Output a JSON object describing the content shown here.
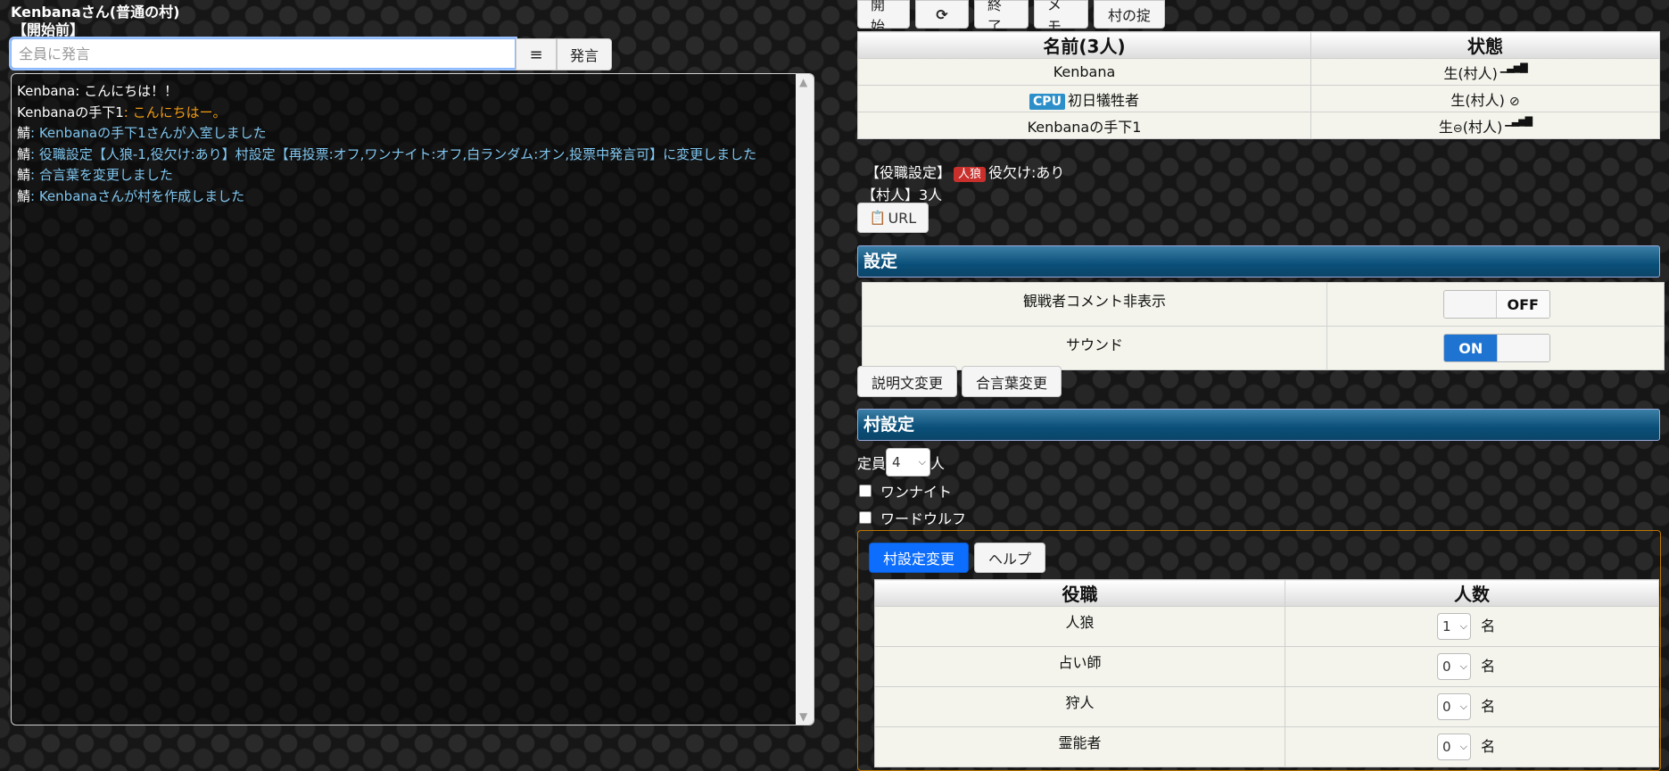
{
  "header": {
    "village_title": "Kenbanaさん(普通の村)",
    "phase": "【開始前】"
  },
  "say": {
    "placeholder": "全員に発言",
    "menu_icon": "≡",
    "send_label": "発言"
  },
  "log": [
    {
      "speaker": "Kenbana",
      "sep": ": ",
      "text": "こんにちは！！",
      "color": "#ffffff"
    },
    {
      "speaker": "Kenbanaの手下1",
      "sep": ": ",
      "text": "こんにちはー。",
      "color": "#f39c12"
    },
    {
      "speaker": "鯖",
      "sep": ": ",
      "text": "Kenbanaの手下1さんが入室しました",
      "color": "#7fc6ef"
    },
    {
      "speaker": "鯖",
      "sep": ": ",
      "text": "役職設定【人狼-1,役欠け:あり】村設定【再投票:オフ,ワンナイト:オフ,白ランダム:オン,投票中発言可】に変更しました",
      "color": "#7fc6ef"
    },
    {
      "speaker": "鯖",
      "sep": ": ",
      "text": "合言葉を変更しました",
      "color": "#7fc6ef"
    },
    {
      "speaker": "鯖",
      "sep": ": ",
      "text": "Kenbanaさんが村を作成しました",
      "color": "#7fc6ef"
    }
  ],
  "top_buttons": [
    "開始",
    "⟳",
    "終了",
    "メモ",
    "村の掟"
  ],
  "players": {
    "col_name": "名前(3人)",
    "col_status": "状態",
    "rows": [
      {
        "name": "Kenbana",
        "cpu": "",
        "status": "生(村人)",
        "status_icon": "signal-icon",
        "mid_icon": ""
      },
      {
        "name": "初日犠牲者",
        "cpu": "CPU",
        "status": "生(村人)",
        "status_icon": "no-entry-icon",
        "mid_icon": ""
      },
      {
        "name": "Kenbanaの手下1",
        "cpu": "",
        "status": "生(村人)",
        "status_icon": "signal-icon",
        "mid_icon": "minus-circle-icon"
      }
    ]
  },
  "role_config": {
    "prefix": "【役職設定】",
    "wolf_badge": "人狼",
    "missing": "役欠け:あり",
    "villagers": "【村人】3人"
  },
  "url_button": "URL",
  "settings": {
    "title": "設定",
    "rows": [
      {
        "label": "観戦者コメント非表示",
        "value": "OFF"
      },
      {
        "label": "サウンド",
        "value": "ON"
      }
    ]
  },
  "desc_buttons": [
    "説明文変更",
    "合言葉変更"
  ],
  "village_settings": {
    "title": "村設定",
    "capacity_prefix": "定員",
    "capacity_value": "4",
    "capacity_suffix": "人",
    "checkboxes": [
      "ワンナイト",
      "ワードウルフ"
    ]
  },
  "role_panel": {
    "apply_label": "村設定変更",
    "help_label": "ヘルプ",
    "col_role": "役職",
    "col_count": "人数",
    "unit": "名",
    "roles": [
      {
        "name": "人狼",
        "count": "1"
      },
      {
        "name": "占い師",
        "count": "0"
      },
      {
        "name": "狩人",
        "count": "0"
      },
      {
        "name": "霊能者",
        "count": "0"
      }
    ]
  },
  "colors": {
    "accent_blue": "#0d6efd",
    "section_bar": "#0b4568",
    "log_system": "#7fc6ef",
    "log_orange": "#f39c12",
    "wolf_red": "#c9302c",
    "cpu_blue": "#2c8fc9"
  }
}
